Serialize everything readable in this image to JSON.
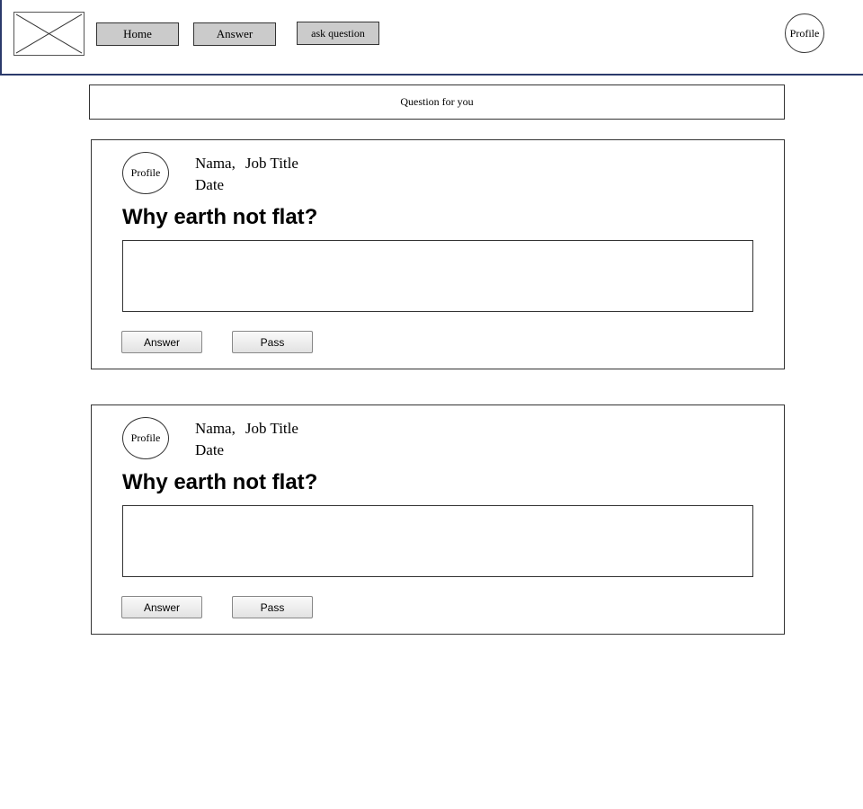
{
  "header": {
    "logo": {
      "icon": "image-placeholder-icon"
    },
    "nav": {
      "home_label": "Home",
      "answer_label": "Answer",
      "ask_question_label": "ask question"
    },
    "profile_label": "Profile"
  },
  "section": {
    "title": "Question for you"
  },
  "questions": [
    {
      "avatar_label": "Profile",
      "name": "Nama,",
      "job_title": "Job Title",
      "date": "Date",
      "question": "Why earth not flat?",
      "answer_value": "",
      "answer_button_label": "Answer",
      "pass_button_label": "Pass"
    },
    {
      "avatar_label": "Profile",
      "name": "Nama,",
      "job_title": "Job Title",
      "date": "Date",
      "question": "Why earth not flat?",
      "answer_value": "",
      "answer_button_label": "Answer",
      "pass_button_label": "Pass"
    }
  ],
  "colors": {
    "header_border": "#2b3a6b",
    "nav_button_bg": "#cbcbcb"
  }
}
